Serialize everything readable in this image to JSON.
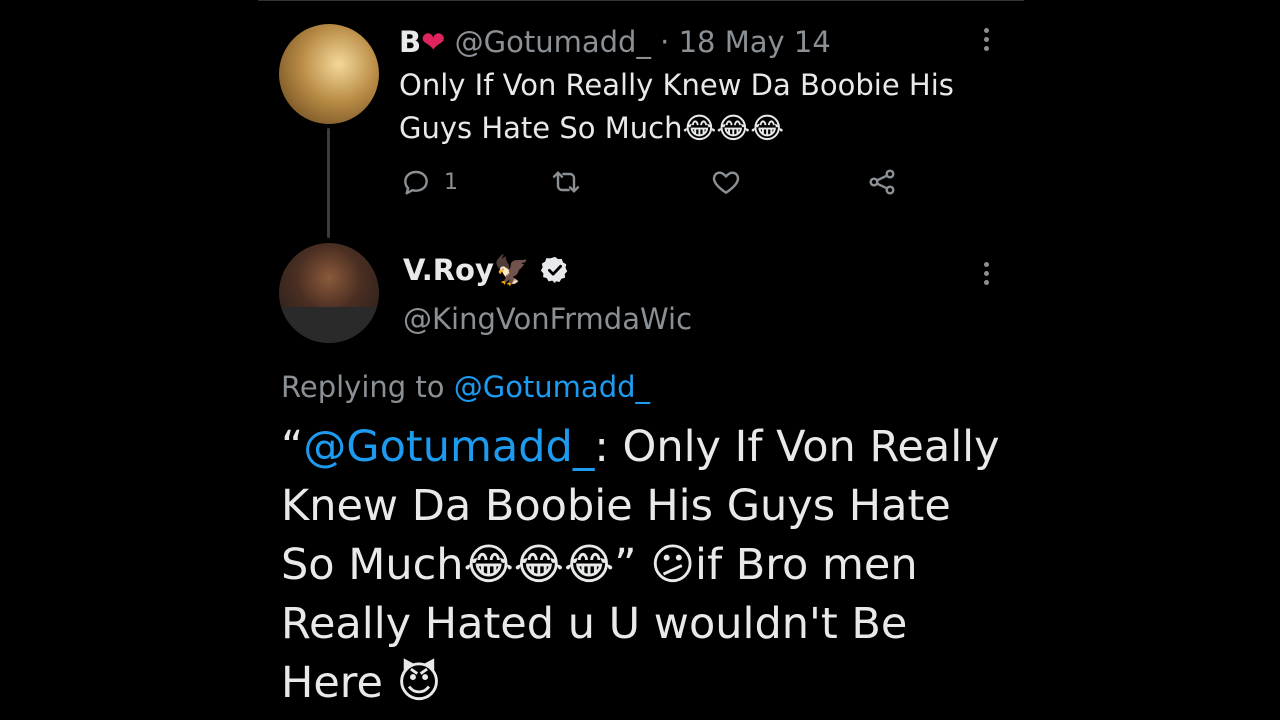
{
  "tweet1": {
    "display_name": "B",
    "name_emoji": "❤",
    "handle": "@Gotumadd_",
    "separator": "·",
    "date": "18 May 14",
    "body": "Only If Von Really Knew Da Boobie His Guys Hate So Much😂😂😂",
    "reply_count": "1"
  },
  "tweet2": {
    "display_name": "V.Roy🦅",
    "handle": "@KingVonFrmdaWic",
    "replying_prefix": "Replying to",
    "replying_handle": "@Gotumadd_",
    "quote_open": "“",
    "quoted_handle": "@Gotumadd_",
    "body_rest": ": Only If Von Really Knew Da Boobie His Guys Hate So Much😂😂😂” 😕if Bro men Really Hated u U wouldn't Be Here 😈"
  },
  "colors": {
    "background": "#000000",
    "text": "#e7e9ea",
    "muted": "#8b9095",
    "link": "#1d9bf0",
    "heart": "#e0245e"
  },
  "icons": {
    "reply": "reply-icon",
    "retweet": "retweet-icon",
    "like": "heart-icon",
    "share": "share-icon",
    "more": "more-icon",
    "verified": "verified-badge-icon"
  }
}
